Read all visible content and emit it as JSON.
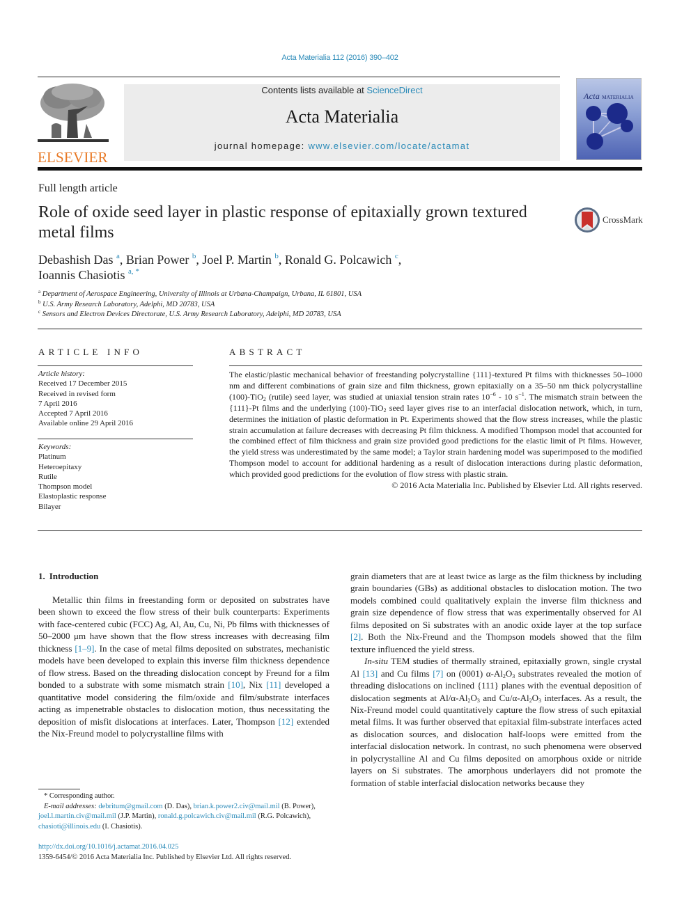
{
  "header": {
    "journal_ref": "Acta Materialia 112 (2016) 390–402",
    "publisher_logo": "ELSEVIER",
    "contents_prefix": "Contents lists available at ",
    "contents_link": "ScienceDirect",
    "journal_title": "Acta Materialia",
    "homepage_prefix": "journal homepage: ",
    "homepage_link": "www.elsevier.com/locate/actamat",
    "cover_title_a": "Acta",
    "cover_title_b": "MATERIALIA"
  },
  "article": {
    "type": "Full length article",
    "title": "Role of oxide seed layer in plastic response of epitaxially grown textured metal films",
    "crossmark_label": "CrossMark",
    "authors": [
      {
        "name": "Debashish Das",
        "marks": "a",
        "sep": ", "
      },
      {
        "name": "Brian Power",
        "marks": "b",
        "sep": ", "
      },
      {
        "name": "Joel P. Martin",
        "marks": "b",
        "sep": ", "
      },
      {
        "name": "Ronald G. Polcawich",
        "marks": "c",
        "sep": ","
      },
      {
        "name": "Ioannis Chasiotis",
        "marks": "a, *",
        "sep": ""
      }
    ],
    "affiliations": [
      {
        "mark": "a",
        "text": "Department of Aerospace Engineering, University of Illinois at Urbana-Champaign, Urbana, IL 61801, USA"
      },
      {
        "mark": "b",
        "text": "U.S. Army Research Laboratory, Adelphi, MD 20783, USA"
      },
      {
        "mark": "c",
        "text": "Sensors and Electron Devices Directorate, U.S. Army Research Laboratory, Adelphi, MD 20783, USA"
      }
    ]
  },
  "article_info": {
    "heading": "ARTICLE INFO",
    "history_label": "Article history:",
    "history": [
      "Received 17 December 2015",
      "Received in revised form",
      "7 April 2016",
      "Accepted 7 April 2016",
      "Available online 29 April 2016"
    ],
    "keywords_label": "Keywords:",
    "keywords": [
      "Platinum",
      "Heteroepitaxy",
      "Rutile",
      "Thompson model",
      "Elastoplastic response",
      "Bilayer"
    ]
  },
  "abstract": {
    "heading": "ABSTRACT",
    "p1": "The elastic/plastic mechanical behavior of freestanding polycrystalline {111}-textured Pt films with thicknesses 50–1000 nm and different combinations of grain size and film thickness, grown epitaxially on a 35–50 nm thick polycrystalline (100)-TiO",
    "p2": " (rutile) seed layer, was studied at uniaxial tension strain rates 10",
    "exp1": "−6",
    "p3": " - 10 s",
    "exp2": "−1",
    "p4": ". The mismatch strain between the {111}-Pt films and the underlying (100)-TiO",
    "p5": " seed layer gives rise to an interfacial dislocation network, which, in turn, determines the initiation of plastic deformation in Pt. Experiments showed that the flow stress increases, while the plastic strain accumulation at failure decreases with decreasing Pt film thickness. A modified Thompson model that accounted for the combined effect of film thickness and grain size provided good predictions for the elastic limit of Pt films. However, the yield stress was underestimated by the same model; a Taylor strain hardening model was superimposed to the modified Thompson model to account for additional hardening as a result of dislocation interactions during plastic deformation, which provided good predictions for the evolution of flow stress with plastic strain.",
    "sub2": "2",
    "copyright": "© 2016 Acta Materialia Inc. Published by Elsevier Ltd. All rights reserved."
  },
  "introduction": {
    "number": "1.",
    "heading": "Introduction",
    "left": {
      "t1": "Metallic thin films in freestanding form or deposited on substrates have been shown to exceed the flow stress of their bulk counterparts: Experiments with face-centered cubic (FCC) Ag, Al, Au, Cu, Ni, Pb films with thicknesses of 50–2000 μm have shown that the flow stress increases with decreasing film thickness ",
      "r1": "[1–9]",
      "t2": ". In the case of metal films deposited on substrates, mechanistic models have been developed to explain this inverse film thickness dependence of flow stress. Based on the threading dislocation concept by Freund for a film bonded to a substrate with some mismatch strain ",
      "r2": "[10]",
      "t3": ", Nix ",
      "r3": "[11]",
      "t4": " developed a quantitative model considering the film/oxide and film/substrate interfaces acting as impenetrable obstacles to dislocation motion, thus necessitating the deposition of misfit dislocations at interfaces. Later, Thompson ",
      "r4": "[12]",
      "t5": " extended the Nix-Freund model to polycrystalline films with"
    },
    "right": {
      "t1": "grain diameters that are at least twice as large as the film thickness by including grain boundaries (GBs) as additional obstacles to dislocation motion. The two models combined could qualitatively explain the inverse film thickness and grain size dependence of flow stress that was experimentally observed for Al films deposited on Si substrates with an anodic oxide layer at the top surface ",
      "r1": "[2]",
      "t2": ". Both the Nix-Freund and the Thompson models showed that the film texture influenced the yield stress.",
      "p2_italic": "In-situ",
      "p2_t1": " TEM studies of thermally strained, epitaxially grown, single crystal Al ",
      "p2_r1": "[13]",
      "p2_t2": " and Cu films ",
      "p2_r2": "[7]",
      "p2_t3": " on (0001) α-Al",
      "p2_t4": "O",
      "p2_t5": " substrates revealed the motion of threading dislocations on inclined {111} planes with the eventual deposition of dislocation segments at Al/α-Al",
      "p2_t6": "O",
      "p2_t7": " and Cu/α-Al",
      "p2_t8": "O",
      "p2_t9": " interfaces. As a result, the Nix-Freund model could quantitatively capture the flow stress of such epitaxial metal films. It was further observed that epitaxial film-substrate interfaces acted as dislocation sources, and dislocation half-loops were emitted from the interfacial dislocation network. In contrast, no such phenomena were observed in polycrystalline Al and Cu films deposited on amorphous oxide or nitride layers on Si substrates. The amorphous underlayers did not promote the formation of stable interfacial dislocation networks because they",
      "sub2": "2",
      "sub3": "3"
    }
  },
  "footnotes": {
    "corresponding": "* Corresponding author.",
    "email_label": "E-mail addresses:",
    "emails": [
      {
        "email": "debritum@gmail.com",
        "who": " (D. Das), "
      },
      {
        "email": "brian.k.power2.civ@mail.mil",
        "who": " (B. Power), "
      },
      {
        "email": "joel.l.martin.civ@mail.mil",
        "who": " (J.P. Martin), "
      },
      {
        "email": "ronald.g.polcawich.civ@mail.mil",
        "who": " (R.G. Polcawich), "
      },
      {
        "email": "chasioti@illinois.edu",
        "who": " (I. Chasiotis)."
      }
    ]
  },
  "footer": {
    "doi": "http://dx.doi.org/10.1016/j.actamat.2016.04.025",
    "issn": "1359-6454/© 2016 Acta Materialia Inc. Published by Elsevier Ltd. All rights reserved."
  }
}
